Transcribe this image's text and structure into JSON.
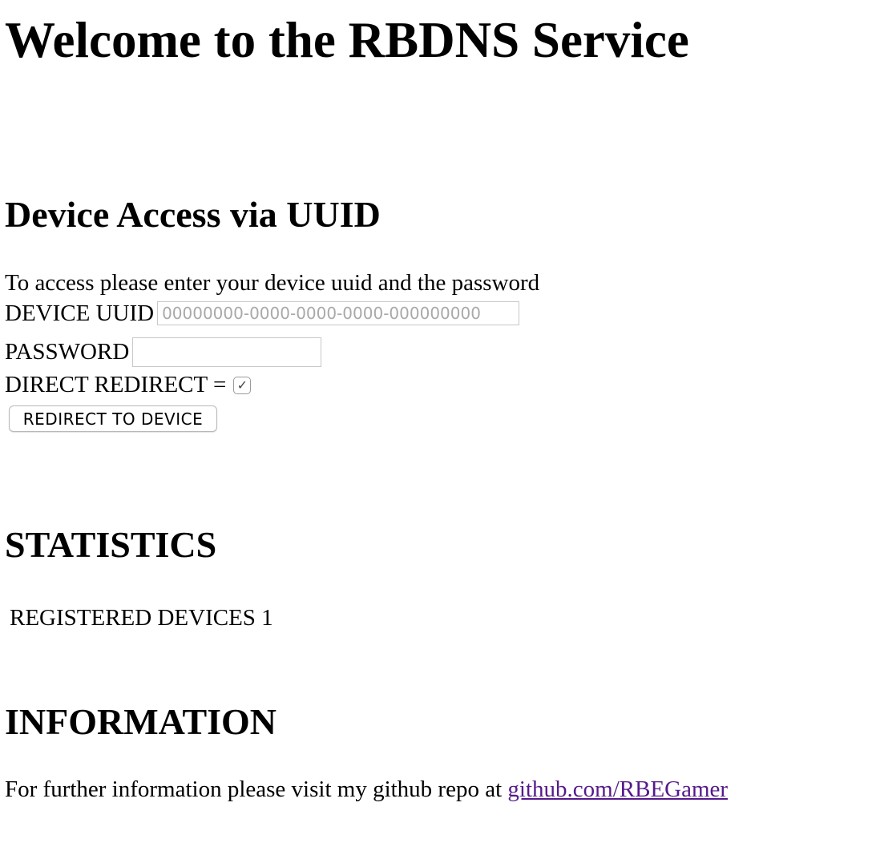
{
  "page": {
    "title": "Welcome to the RBDNS Service"
  },
  "device_access": {
    "heading": "Device Access via UUID",
    "instructions": "To access please enter your device uuid and the password",
    "uuid_label": "DEVICE UUID",
    "uuid_placeholder": "00000000-0000-0000-0000-000000000",
    "uuid_value": "",
    "password_label": "PASSWORD",
    "password_value": "",
    "redirect_label": "DIRECT REDIRECT =",
    "redirect_checked": true,
    "checkmark_glyph": "✓",
    "submit_label": "REDIRECT TO DEVICE"
  },
  "statistics": {
    "heading": "STATISTICS",
    "registered_label": "REGISTERED DEVICES",
    "registered_count": "1"
  },
  "information": {
    "heading": "INFORMATION",
    "text": "For further information please visit my github repo at",
    "link_text": "github.com/RBEGamer"
  },
  "colors": {
    "link_visited": "#551a8b",
    "placeholder": "#a9a9a9",
    "input_border": "#c8c8c8"
  }
}
